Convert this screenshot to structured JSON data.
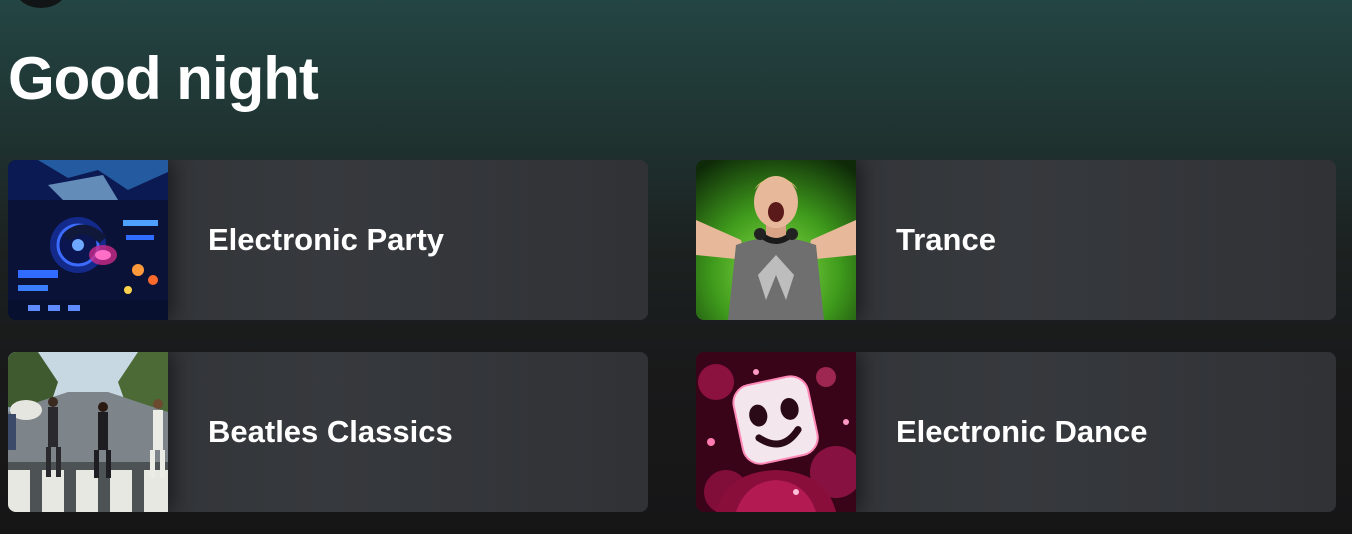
{
  "header": {
    "greeting": "Good night"
  },
  "playlists": [
    {
      "title": "Electronic Party",
      "cover_icon": "dj-mixer-image"
    },
    {
      "title": "Trance",
      "cover_icon": "dj-performer-image"
    },
    {
      "title": "Beatles Classics",
      "cover_icon": "abbey-road-crosswalk-image"
    },
    {
      "title": "Electronic Dance",
      "cover_icon": "marshmello-helmet-image"
    }
  ],
  "colors": {
    "header_gradient_top": "#234543",
    "background": "#161617",
    "card": "#36393d",
    "text": "#ffffff"
  }
}
